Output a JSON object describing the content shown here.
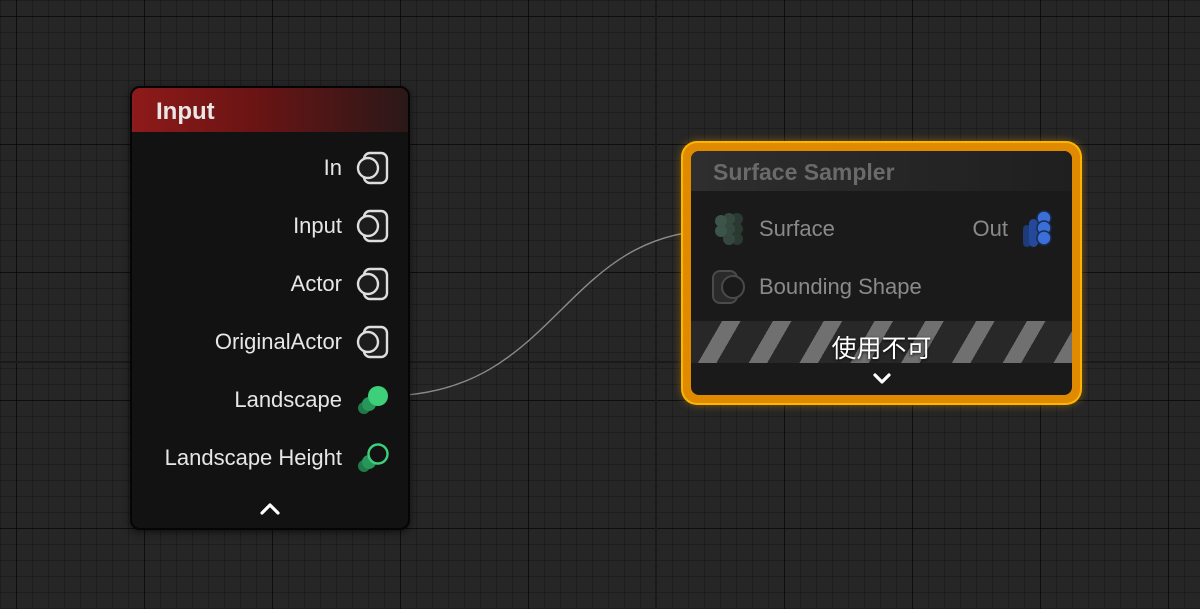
{
  "input_node": {
    "title": "Input",
    "pins": [
      {
        "label": "In",
        "icon": "data-pin-icon"
      },
      {
        "label": "Input",
        "icon": "data-pin-icon"
      },
      {
        "label": "Actor",
        "icon": "data-pin-icon"
      },
      {
        "label": "OriginalActor",
        "icon": "data-pin-icon"
      },
      {
        "label": "Landscape",
        "icon": "landscape-pin-icon"
      },
      {
        "label": "Landscape Height",
        "icon": "landscape-height-pin-icon"
      }
    ],
    "collapse_icon": "chevron-up-icon"
  },
  "sampler_node": {
    "title": "Surface Sampler",
    "inputs": [
      {
        "label": "Surface",
        "icon": "surface-pin-icon"
      },
      {
        "label": "Bounding Shape",
        "icon": "bounding-shape-pin-icon"
      }
    ],
    "outputs": [
      {
        "label": "Out",
        "icon": "points-pin-icon"
      }
    ],
    "disabled_label": "使用不可",
    "expand_icon": "chevron-down-icon"
  },
  "colors": {
    "input_header": "#8e1a1a",
    "sampler_border": "#ffa500",
    "landscape_pin": "#3ecf7a",
    "points_pin": "#3a6fd8"
  }
}
